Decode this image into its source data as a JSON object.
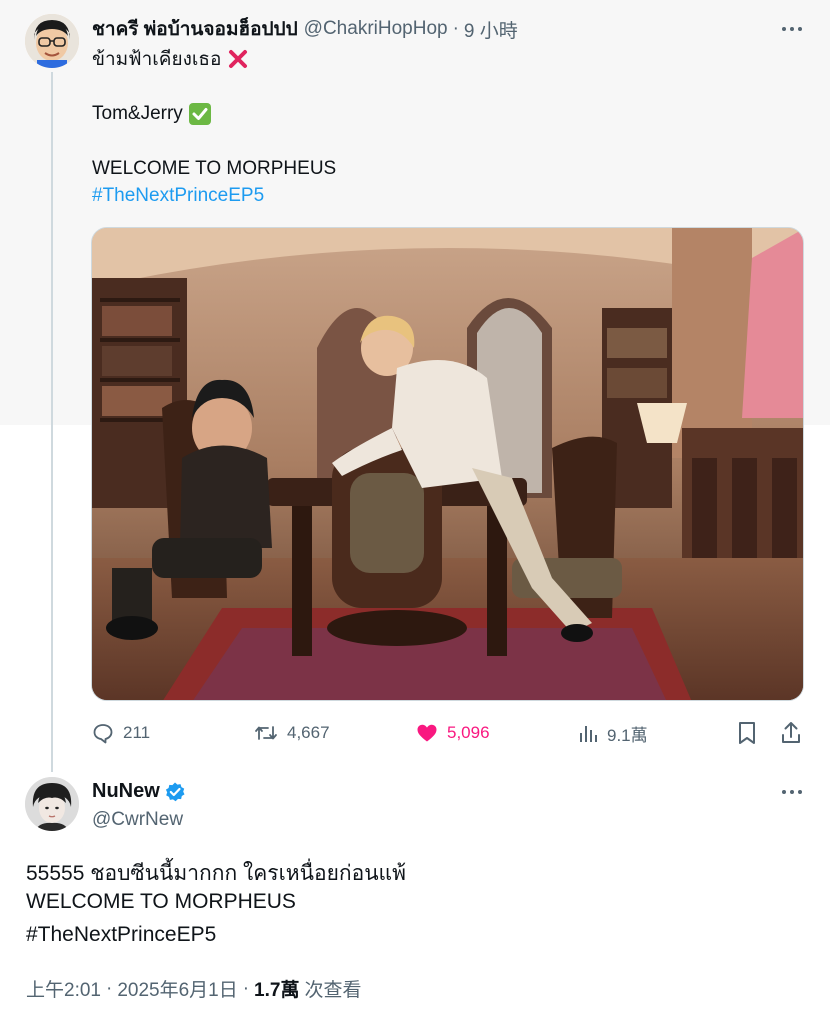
{
  "quoted_tweet": {
    "display_name": "ชาครี พ่อบ้านจอมฮ็อปปป",
    "handle": "@ChakriHopHop",
    "separator": "·",
    "time_ago": "9 小時",
    "lines": [
      "ข้ามฟ้าเคียงเธอ",
      "Tom&Jerry",
      "WELCOME TO MORPHEUS"
    ],
    "line_icons": [
      "cross-mark-icon",
      "check-mark-icon"
    ],
    "hashtag": "#TheNextPrinceEP5",
    "actions": {
      "replies": "211",
      "retweets": "4,667",
      "likes": "5,096",
      "views": "9.1萬"
    }
  },
  "reply_tweet": {
    "display_name": "NuNew",
    "handle": "@CwrNew",
    "verified": true,
    "lines": [
      "55555 ชอบซีนนี้มากกก ใครเหนื่อยก่อนแพ้",
      "WELCOME TO MORPHEUS"
    ],
    "hashtag": "#TheNextPrinceEP5",
    "meta": {
      "time": "上午2:01",
      "separator": "·",
      "date": "2025年6月1日",
      "separator2": "·",
      "views_count": "1.7萬",
      "views_label": "次查看"
    }
  },
  "colors": {
    "accent": "#1d9bf0",
    "like": "#f91880",
    "muted": "#536471",
    "cross": "#e0245e",
    "check": "#6cb844"
  }
}
